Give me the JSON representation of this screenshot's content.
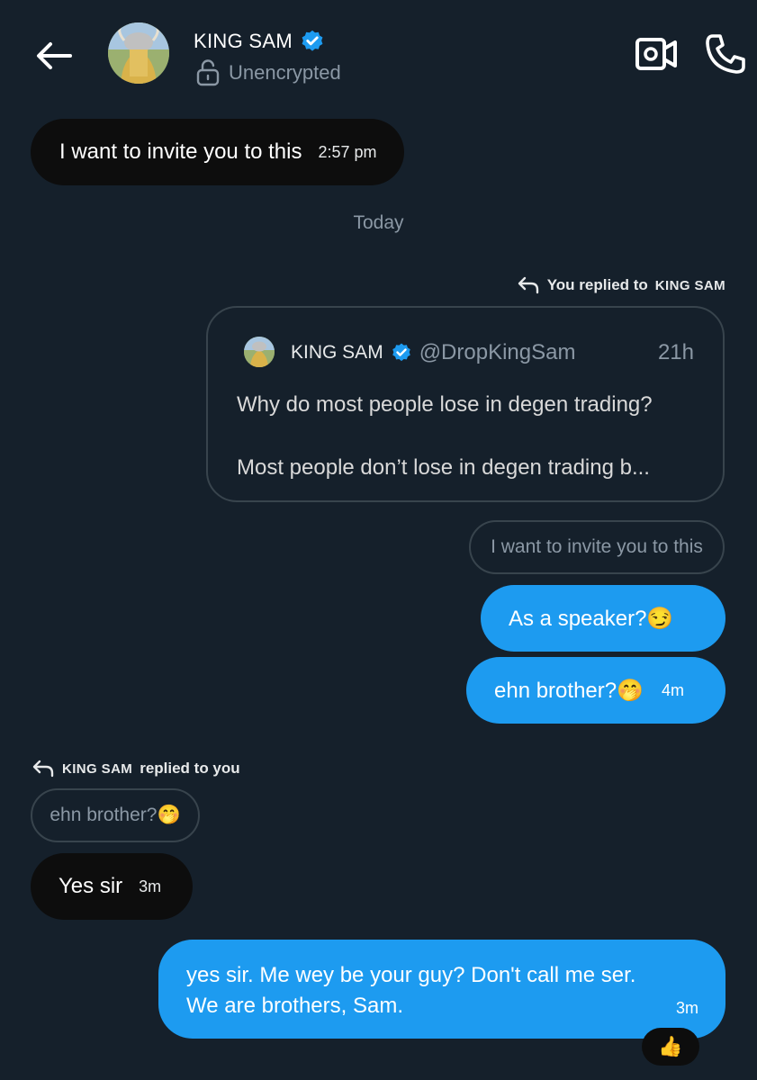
{
  "header": {
    "contact_name": "KING SAM",
    "encryption_status": "Unencrypted",
    "icons": {
      "back": "back-arrow-icon",
      "verified": "verified-badge-icon",
      "lock": "unlocked-icon",
      "video": "video-call-icon",
      "phone": "phone-icon"
    }
  },
  "messages": {
    "m1": {
      "text": "I want to invite you to this",
      "time": "2:57 pm"
    },
    "day_separator": "Today",
    "reply_note_1": {
      "prefix": "You replied to",
      "name": "KING SAM"
    },
    "quote": {
      "name": "KING SAM",
      "handle": "@DropKingSam",
      "time": "21h",
      "line1": "Why do most people lose in degen trading?",
      "line2": "Most people don’t lose in degen trading b..."
    },
    "quoted_reply_1": "I want to invite you to this",
    "m2": {
      "text": "As a speaker?😏"
    },
    "m3": {
      "text": "ehn brother?🤭",
      "time": "4m"
    },
    "reply_note_2": {
      "name": "KING SAM",
      "suffix": "replied to you"
    },
    "quoted_reply_2": "ehn brother?🤭",
    "m4": {
      "text": "Yes sir",
      "time": "3m"
    },
    "m5": {
      "line1": "yes sir. Me wey be your guy? Don't call me ser.",
      "line2": "We are brothers, Sam.",
      "time": "3m"
    },
    "reaction": "👍"
  },
  "colors": {
    "background": "#15202b",
    "outgoing_bubble": "#1d9bf0",
    "incoming_bubble": "#0d0d0d",
    "muted_text": "#8b98a5",
    "verified": "#1d9bf0"
  }
}
